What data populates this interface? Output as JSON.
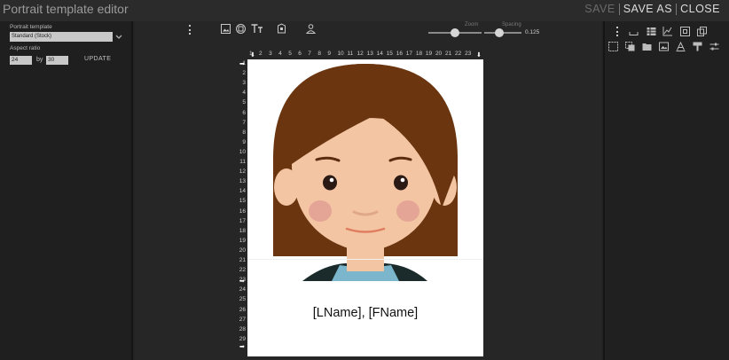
{
  "window": {
    "title": "Portrait template editor"
  },
  "actions": {
    "save": "SAVE",
    "save_as": "SAVE AS",
    "close": "CLOSE"
  },
  "left_panel": {
    "template_label": "Portrait template",
    "template_value": "Standard (Stock)",
    "aspect_label": "Aspect ratio",
    "aspect_width": "24",
    "aspect_by": "by",
    "aspect_height": "30",
    "update_label": "UPDATE"
  },
  "toolbar": {
    "icons": [
      "more-vert-icon",
      "image-icon",
      "circle-frame-icon",
      "text-size-icon",
      "badge-icon",
      "person-icon"
    ],
    "zoom_label": "Zoom",
    "zoom_value": 0.15,
    "spacing_label": "Spacing",
    "spacing_value": "0.125"
  },
  "right_toolbar": {
    "row1": [
      "more-vert-icon",
      "underline-icon",
      "table-icon",
      "chart-axes-icon",
      "grid-icon",
      "copy-icon"
    ],
    "row2": [
      "select-icon",
      "group-icon",
      "layers-icon",
      "gallery-icon",
      "font-icon",
      "paint-roller-icon",
      "sliders-icon"
    ]
  },
  "ruler": {
    "top": [
      "1",
      "2",
      "3",
      "4",
      "5",
      "6",
      "7",
      "8",
      "9",
      "10",
      "11",
      "12",
      "13",
      "14",
      "15",
      "16",
      "17",
      "18",
      "19",
      "20",
      "21",
      "22",
      "23"
    ],
    "left": [
      "1",
      "2",
      "3",
      "4",
      "5",
      "6",
      "7",
      "8",
      "9",
      "10",
      "11",
      "12",
      "13",
      "14",
      "15",
      "16",
      "17",
      "18",
      "19",
      "20",
      "21",
      "22",
      "23",
      "24",
      "25",
      "26",
      "27",
      "28",
      "29"
    ]
  },
  "canvas": {
    "name_placeholder": "[LName], [FName]",
    "colors": {
      "hair": "#6b3510",
      "skin": "#f3c5a3",
      "cheek": "#e5a596",
      "shirt": "#1b2b2b",
      "collar": "#7bb6cc"
    }
  }
}
